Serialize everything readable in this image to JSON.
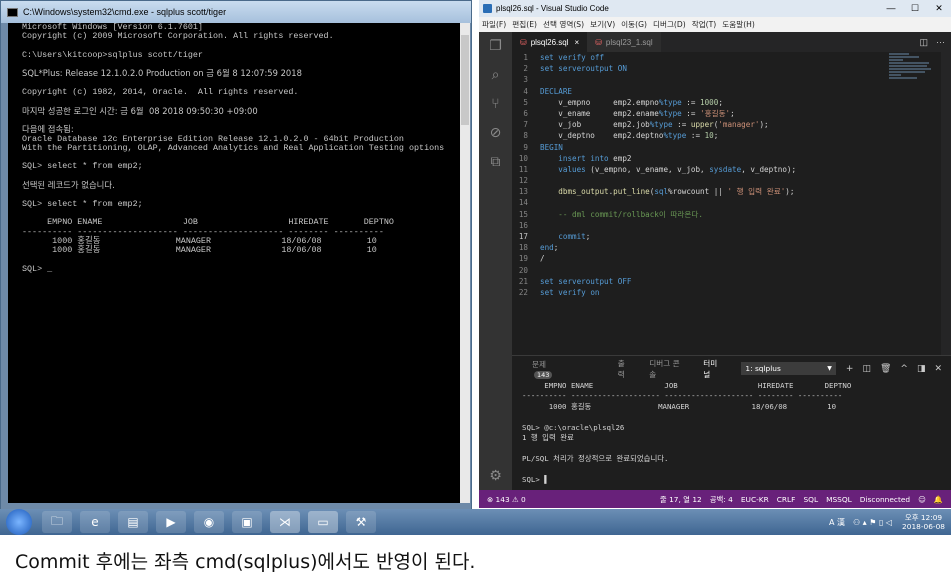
{
  "cmd": {
    "title": "C:\\Windows\\system32\\cmd.exe - sqlplus  scott/tiger",
    "lines": [
      "Microsoft Windows [Version 6.1.7601]",
      "Copyright (c) 2009 Microsoft Corporation. All rights reserved.",
      "",
      "C:\\Users\\kitcoop>sqlplus scott/tiger",
      "",
      "SQL*Plus: Release 12.1.0.2.0 Production on 금 6월 8 12:07:59 2018",
      "",
      "Copyright (c) 1982, 2014, Oracle.  All rights reserved.",
      "",
      "마지막 성공한 로그인 시간: 금 6월  08 2018 09:50:30 +09:00",
      "",
      "다음에 접속됨:",
      "Oracle Database 12c Enterprise Edition Release 12.1.0.2.0 - 64bit Production",
      "With the Partitioning, OLAP, Advanced Analytics and Real Application Testing options",
      "",
      "SQL> select * from emp2;",
      "",
      "선택된 레코드가 없습니다.",
      "",
      "SQL> select * from emp2;",
      "",
      "     EMPNO ENAME                JOB                  HIREDATE       DEPTNO",
      "---------- -------------------- -------------------- -------- ----------",
      "      1000 홍길동               MANAGER              18/06/08         10",
      "      1000 홍길동               MANAGER              18/06/08         10",
      "",
      "SQL> _"
    ]
  },
  "vscode": {
    "title": "plsql26.sql - Visual Studio Code",
    "menu": [
      "파일(F)",
      "편집(E)",
      "선택 영역(S)",
      "보기(V)",
      "이동(G)",
      "디버그(D)",
      "작업(T)",
      "도움말(H)"
    ],
    "tabs": [
      {
        "label": "plsql26.sql",
        "close": "×"
      },
      {
        "label": "plsql23_1.sql"
      }
    ],
    "line_numbers": [
      "1",
      "2",
      "3",
      "4",
      "5",
      "6",
      "7",
      "8",
      "9",
      "10",
      "11",
      "12",
      "13",
      "14",
      "15",
      "16",
      "17",
      "18",
      "19",
      "20",
      "21",
      "22"
    ],
    "panel": {
      "tabs": [
        "문제",
        "출력",
        "디버그 콘솔",
        "터미널"
      ],
      "problems_count": "143",
      "terminal_select": "1: sqlplus",
      "terminal_lines": [
        "     EMPNO ENAME                JOB                  HIREDATE       DEPTNO",
        "---------- -------------------- -------------------- -------- ----------",
        "      1000 홍길동               MANAGER              18/06/08         10",
        "",
        "SQL> @c:\\oracle\\plsql26",
        "1 행 입력 완료",
        "",
        "PL/SQL 처리가 정상적으로 완료되었습니다.",
        "",
        "SQL> ▌"
      ]
    },
    "status": {
      "left": "⊗ 143 ⚠ 0",
      "position": "줄 17, 열 12",
      "spaces": "공백: 4",
      "encoding": "EUC-KR",
      "eol": "CRLF",
      "lang": "SQL",
      "mssql": "MSSQL",
      "conn": "Disconnected"
    }
  },
  "taskbar": {
    "ime": "A 漢",
    "time": "오후 12:09",
    "date": "2018-06-08"
  },
  "caption": "Commit 후에는 좌측 cmd(sqlplus)에서도 반영이 된다."
}
